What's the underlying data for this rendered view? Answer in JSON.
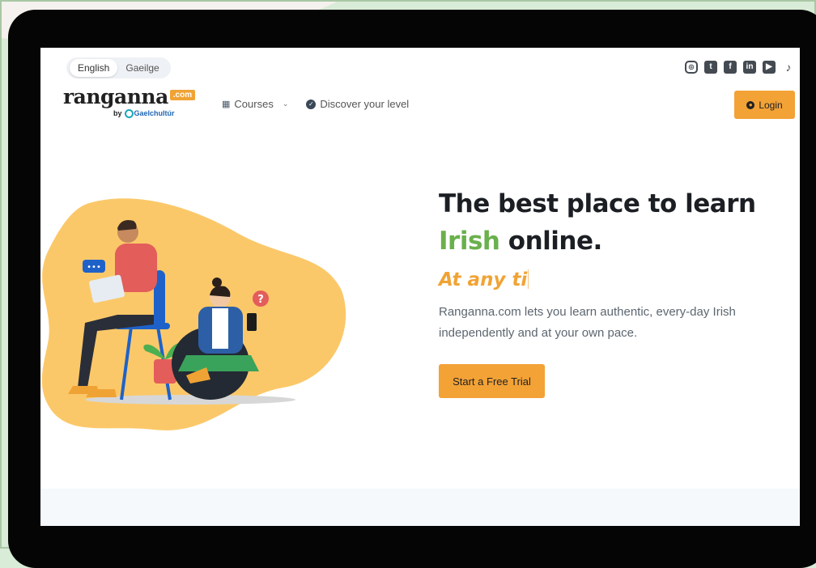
{
  "language_toggle": {
    "english": "English",
    "gaeilge": "Gaeilge"
  },
  "logo": {
    "name": "ranganna",
    "badge": ".com",
    "by": "by",
    "partner": "Gaelchultúr"
  },
  "nav": {
    "courses": "Courses",
    "discover": "Discover your level"
  },
  "social": [
    "instagram-icon",
    "twitter-icon",
    "facebook-icon",
    "linkedin-icon",
    "youtube-icon",
    "tiktok-icon"
  ],
  "login": {
    "label": "Login"
  },
  "hero": {
    "title_line1": "The best place to learn",
    "title_highlight": "Irish",
    "title_line2_rest": " online.",
    "tagline": "At any ti",
    "description": "Ranganna.com lets you learn authentic, every-day Irish independently and at your own pace.",
    "cta": "Start a Free Trial"
  },
  "colors": {
    "accent": "#f3a236",
    "green": "#6ab04c",
    "blob": "#fbc869",
    "frame": "#050505"
  }
}
